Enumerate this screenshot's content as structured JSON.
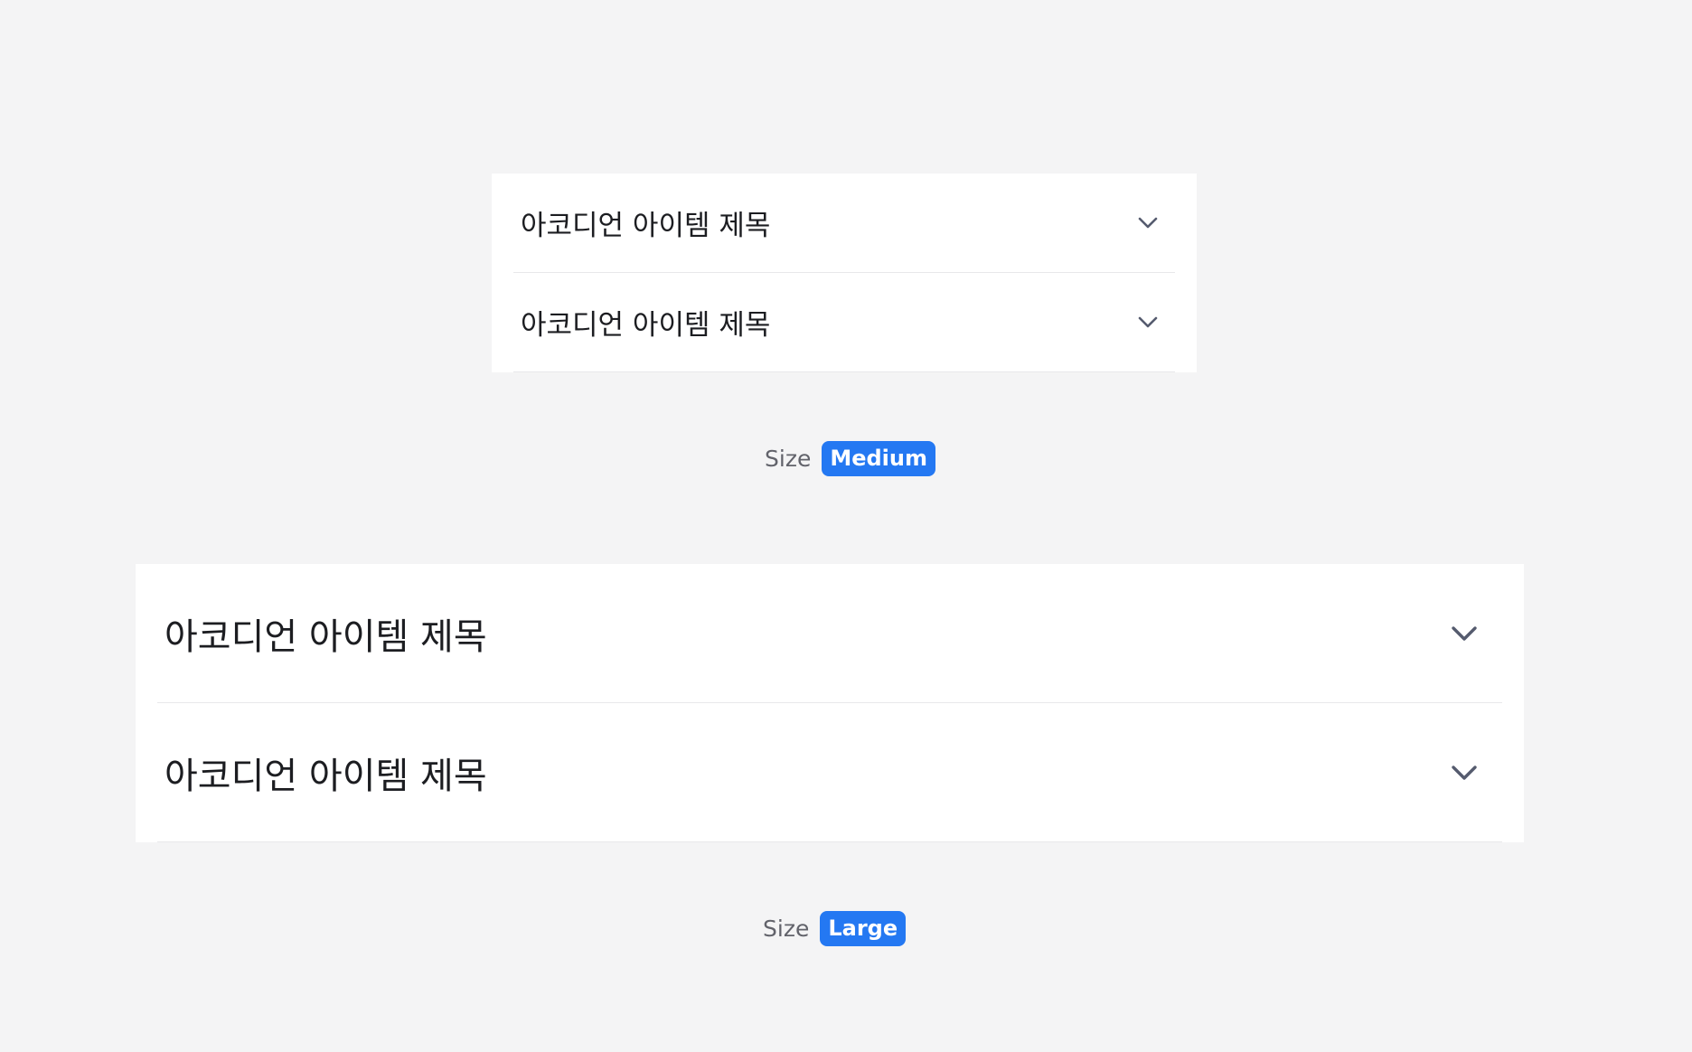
{
  "medium_accordion": {
    "items": [
      {
        "title": "아코디언 아이템 제목"
      },
      {
        "title": "아코디언 아이템 제목"
      }
    ]
  },
  "medium_caption": {
    "label": "Size",
    "badge": "Medium"
  },
  "large_accordion": {
    "items": [
      {
        "title": "아코디언 아이템 제목"
      },
      {
        "title": "아코디언 아이템 제목"
      }
    ]
  },
  "large_caption": {
    "label": "Size",
    "badge": "Large"
  },
  "icons": {
    "expand": "chevron-down-icon"
  },
  "colors": {
    "background": "#f4f4f5",
    "surface": "#ffffff",
    "accent": "#2478f2",
    "title_text": "#1c1d21",
    "chevron": "#555b6e"
  }
}
